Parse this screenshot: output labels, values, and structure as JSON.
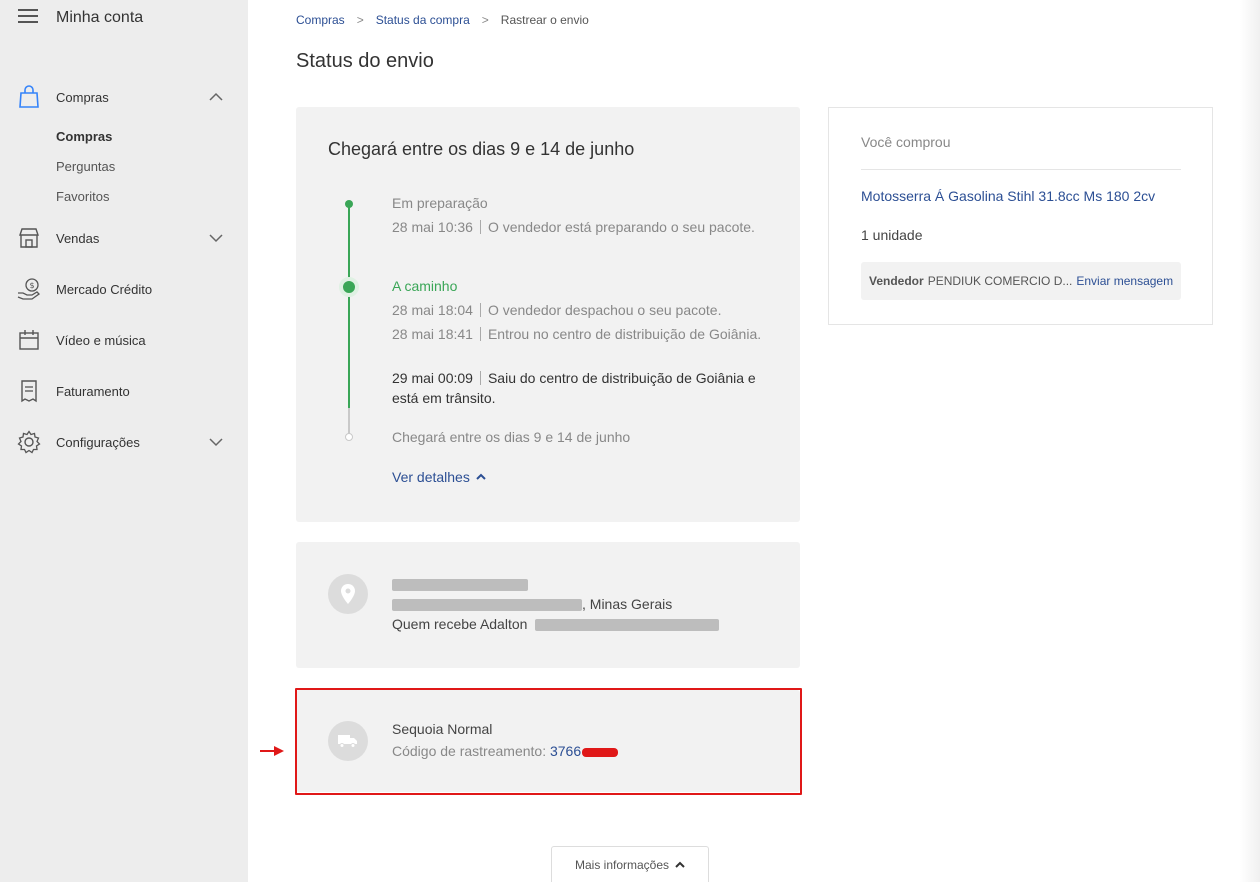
{
  "sidebar": {
    "title": "Minha conta",
    "items": [
      {
        "label": "Compras",
        "icon": "shopping-bag-icon",
        "expanded": true
      },
      {
        "label": "Vendas",
        "icon": "store-icon"
      },
      {
        "label": "Mercado Crédito",
        "icon": "hand-money-icon"
      },
      {
        "label": "Vídeo e música",
        "icon": "calendar-icon"
      },
      {
        "label": "Faturamento",
        "icon": "receipt-icon"
      },
      {
        "label": "Configurações",
        "icon": "gear-icon"
      }
    ],
    "subitems": [
      "Compras",
      "Perguntas",
      "Favoritos"
    ]
  },
  "breadcrumb": [
    "Compras",
    "Status da compra",
    "Rastrear o envio"
  ],
  "page_title": "Status do envio",
  "status": {
    "heading": "Chegará entre os dias 9 e 14 de junho",
    "step1_label": "Em preparação",
    "step1_events": [
      {
        "when": "28 mai 10:36",
        "text": "O vendedor está preparando o seu pacote."
      }
    ],
    "step2_label": "A caminho",
    "step2_events": [
      {
        "when": "28 mai 18:04",
        "text": "O vendedor despachou o seu pacote."
      },
      {
        "when": "28 mai 18:41",
        "text": "Entrou no centro de distribuição de Goiânia."
      },
      {
        "when": "29 mai 00:09",
        "text": "Saiu do centro de distribuição de Goiânia e está em trânsito."
      }
    ],
    "final_label": "Chegará entre os dias 9 e 14 de junho",
    "details_link": "Ver detalhes"
  },
  "address": {
    "state": ", Minas Gerais",
    "receiver_prefix": "Quem recebe Adalton"
  },
  "shipping": {
    "carrier": "Sequoia Normal",
    "tracking_label": "Código de rastreamento:",
    "tracking_visible": "3766"
  },
  "more_info": "Mais informações",
  "purchase": {
    "label": "Você comprou",
    "product": "Motosserra Á Gasolina Stihl 31.8cc Ms 180 2cv",
    "quantity": "1 unidade",
    "seller_key": "Vendedor",
    "seller_name": "PENDIUK COMERCIO D...",
    "message_link": "Enviar mensagem"
  },
  "colors": {
    "sidebar_bg": "#ededed",
    "link_blue": "#2c4f94",
    "status_green": "#3aa657",
    "highlight_red": "#e01818"
  }
}
